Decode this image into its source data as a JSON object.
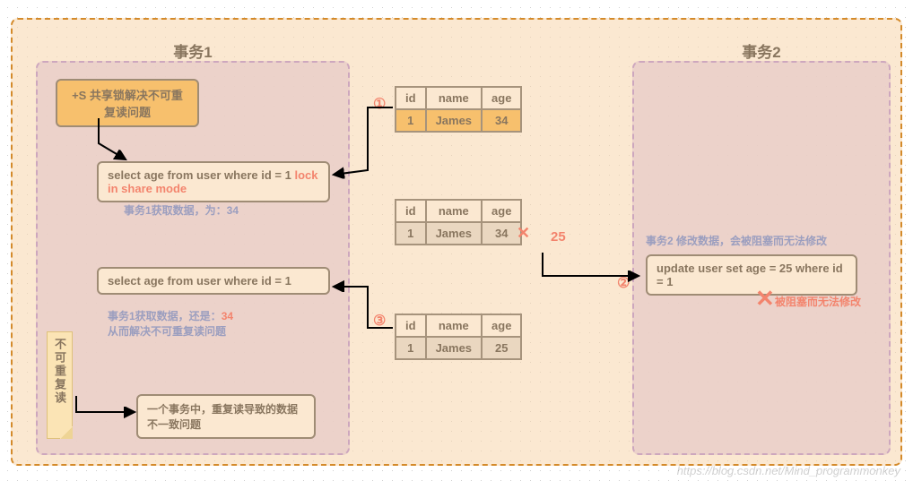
{
  "tx1": {
    "title": "事务1",
    "lock_box": "+S 共享锁解决不可重复读问题",
    "query1_prefix": "select age from user where id = 1 ",
    "query1_red": "lock in share mode",
    "note1": "事务1获取数据，为：34",
    "query2": "select age from user where id = 1",
    "note2_a": "事务1获取数据，还是：",
    "note2_b": "34",
    "note2_c": "从而解决不可重复读问题",
    "sticky": "不可重复读",
    "explain": "一个事务中，重复读导致的数据不一致问题"
  },
  "tx2": {
    "title": "事务2",
    "note": "事务2 修改数据，会被阻塞而无法修改",
    "query": "update user set age = 25 where id = 1",
    "blocked": "被阻塞而无法修改"
  },
  "tables": {
    "headers": {
      "id": "id",
      "name": "name",
      "age": "age"
    },
    "row1": {
      "id": "1",
      "name": "James",
      "age": "34"
    },
    "row2": {
      "id": "1",
      "name": "James",
      "age_crossed": "34",
      "age_new": "25"
    },
    "row3": {
      "id": "1",
      "name": "James",
      "age": "25"
    }
  },
  "steps": {
    "s1": "①",
    "s2": "②",
    "s3": "③"
  },
  "watermark": "https://blog.csdn.net/Mind_programmonkey"
}
